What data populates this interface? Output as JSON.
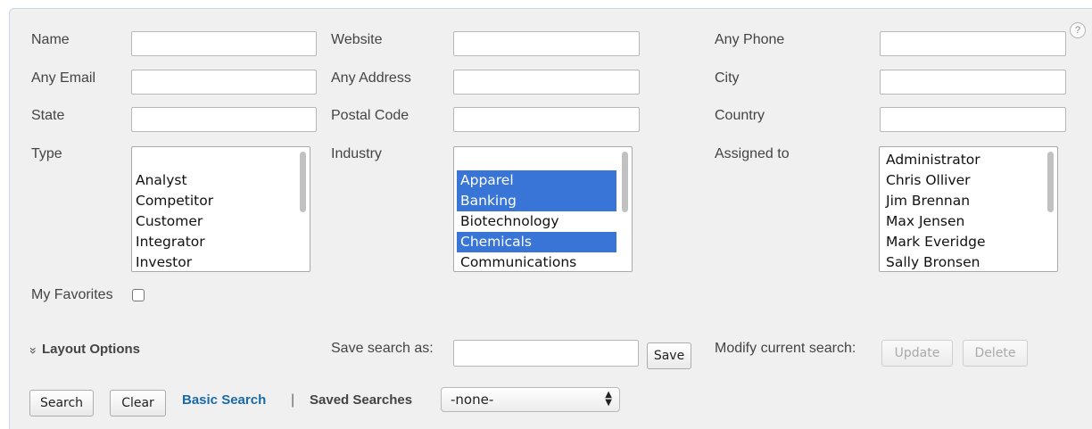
{
  "help": {
    "glyph": "?"
  },
  "fields": {
    "name": {
      "label": "Name",
      "value": ""
    },
    "website": {
      "label": "Website",
      "value": ""
    },
    "any_phone": {
      "label": "Any Phone",
      "value": ""
    },
    "any_email": {
      "label": "Any Email",
      "value": ""
    },
    "any_address": {
      "label": "Any Address",
      "value": ""
    },
    "city": {
      "label": "City",
      "value": ""
    },
    "state": {
      "label": "State",
      "value": ""
    },
    "postal_code": {
      "label": "Postal Code",
      "value": ""
    },
    "country": {
      "label": "Country",
      "value": ""
    }
  },
  "type": {
    "label": "Type",
    "options": [
      {
        "text": "",
        "selected": false
      },
      {
        "text": "Analyst",
        "selected": false
      },
      {
        "text": "Competitor",
        "selected": false
      },
      {
        "text": "Customer",
        "selected": false
      },
      {
        "text": "Integrator",
        "selected": false
      },
      {
        "text": "Investor",
        "selected": false
      }
    ]
  },
  "industry": {
    "label": "Industry",
    "options": [
      {
        "text": "",
        "selected": false
      },
      {
        "text": "Apparel",
        "selected": true
      },
      {
        "text": "Banking",
        "selected": true
      },
      {
        "text": "Biotechnology",
        "selected": false
      },
      {
        "text": "Chemicals",
        "selected": true
      },
      {
        "text": "Communications",
        "selected": false
      }
    ]
  },
  "assigned_to": {
    "label": "Assigned to",
    "options": [
      {
        "text": "Administrator",
        "selected": false
      },
      {
        "text": "Chris Olliver",
        "selected": false
      },
      {
        "text": "Jim Brennan",
        "selected": false
      },
      {
        "text": "Max Jensen",
        "selected": false
      },
      {
        "text": "Mark Everidge",
        "selected": false
      },
      {
        "text": "Sally Bronsen",
        "selected": false
      }
    ]
  },
  "my_favorites": {
    "label": "My Favorites",
    "checked": false
  },
  "layout_options": {
    "icon": "double-chevron-down-icon",
    "glyph": "»",
    "label": "Layout Options"
  },
  "save_search": {
    "label": "Save search as:",
    "value": "",
    "button": "Save"
  },
  "modify_search": {
    "label": "Modify current search:",
    "update": "Update",
    "delete": "Delete"
  },
  "bottom": {
    "search": "Search",
    "clear": "Clear",
    "basic_search": "Basic Search",
    "separator": "|",
    "saved_searches_label": "Saved Searches",
    "saved_searches_value": "-none-",
    "select_arrows": "▲▼"
  },
  "colors": {
    "selection": "#3875d7",
    "link": "#1b6aa8",
    "panel": "#f0f0f0"
  }
}
